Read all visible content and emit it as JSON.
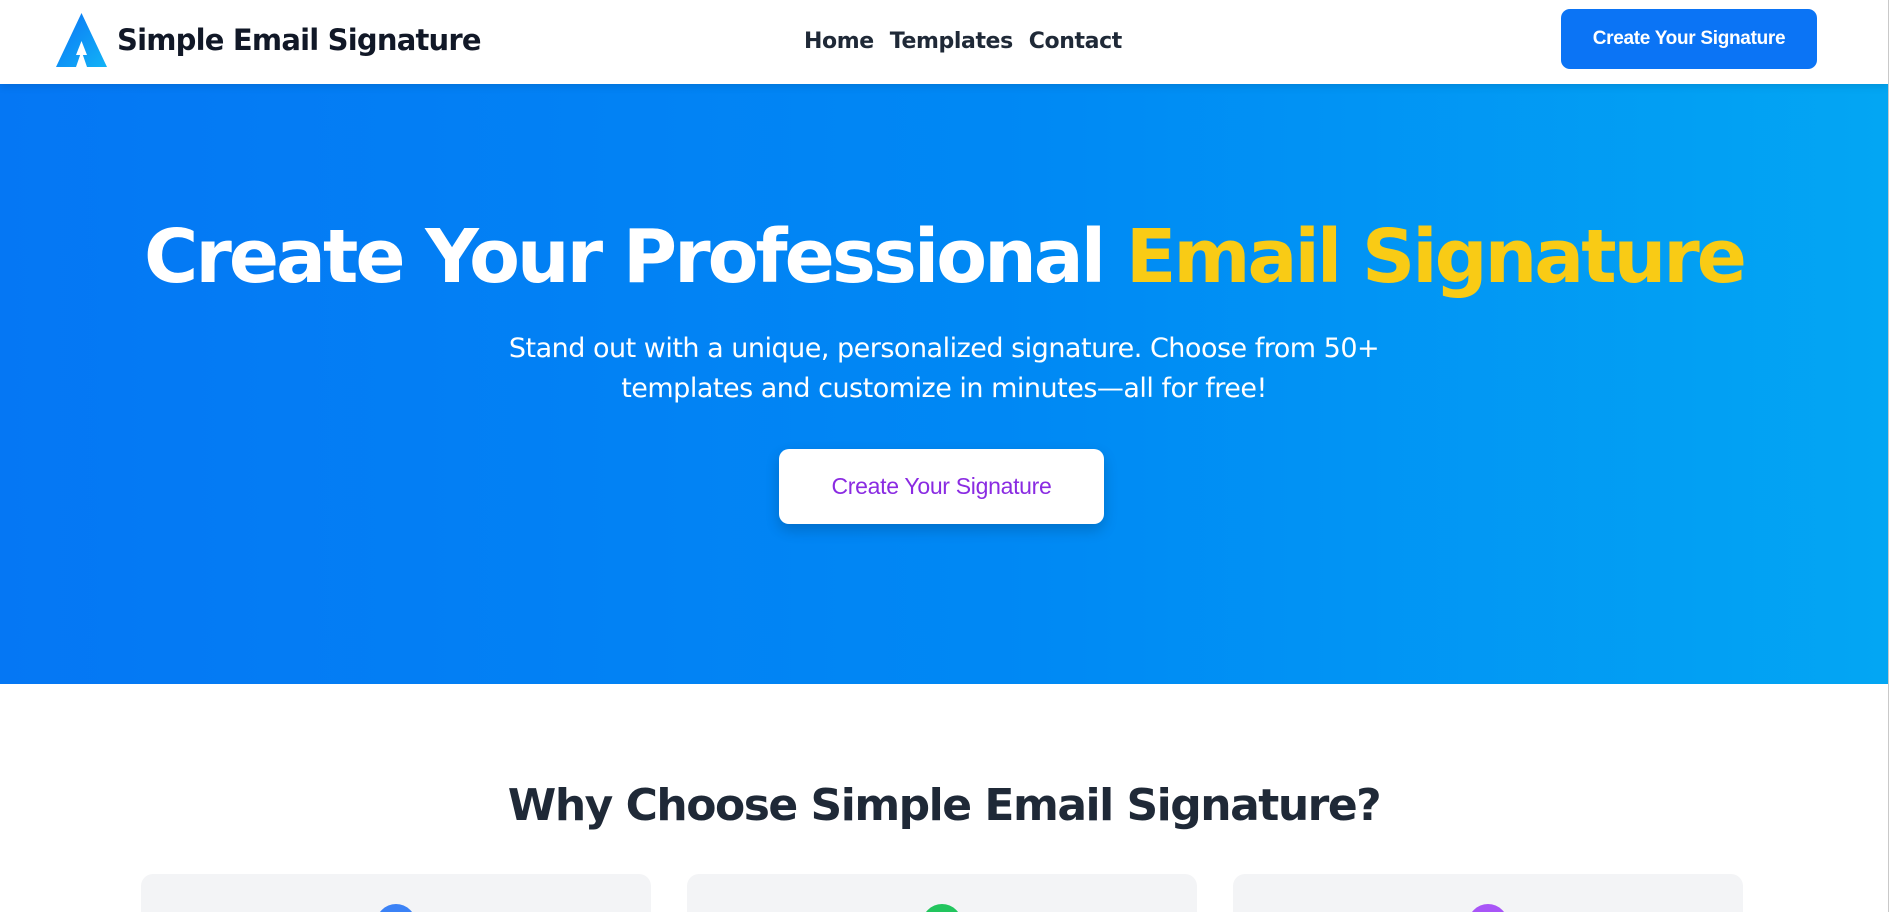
{
  "header": {
    "brand": "Simple Email Signature",
    "nav": [
      "Home",
      "Templates",
      "Contact"
    ],
    "cta_label": "Create Your Signature"
  },
  "hero": {
    "title_main": "Create Your Professional ",
    "title_accent": "Email Signature",
    "subtitle": "Stand out with a unique, personalized signature. Choose from 50+ templates and customize in minutes—all for free!",
    "cta_label": "Create Your Signature"
  },
  "why": {
    "title": "Why Choose Simple Email Signature?",
    "cards": [
      {
        "icon": "feature-icon",
        "color": "#3b82f6"
      },
      {
        "icon": "feature-icon",
        "color": "#22c55e"
      },
      {
        "icon": "feature-icon",
        "color": "#a855f7"
      }
    ]
  },
  "colors": {
    "brand_blue": "#0b74f5",
    "accent_yellow": "#f9cb15",
    "cta_text_purple": "#8a2be2"
  }
}
